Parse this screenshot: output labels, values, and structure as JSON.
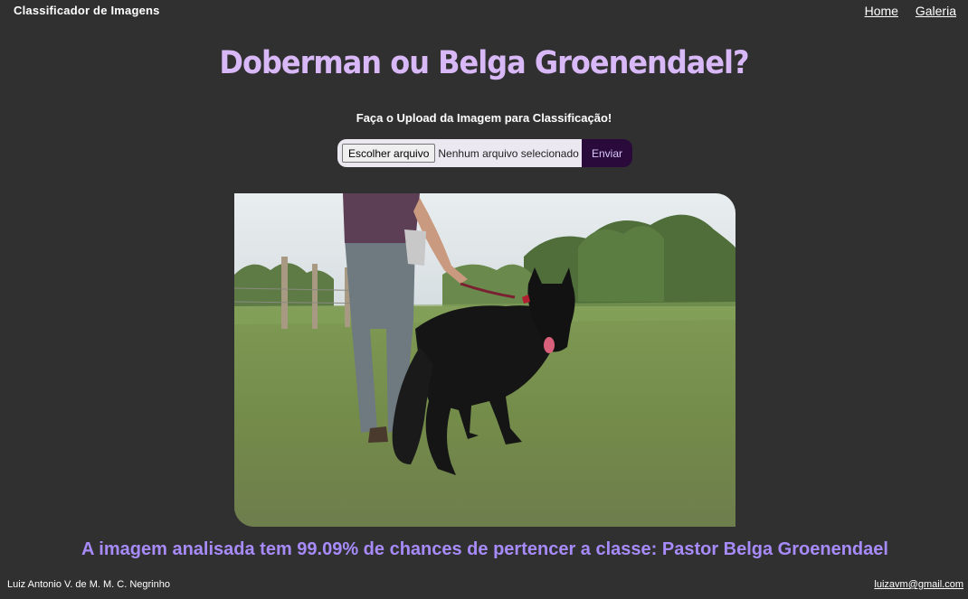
{
  "header": {
    "brand": "Classificador de Imagens",
    "nav": {
      "home": "Home",
      "gallery": "Galeria"
    }
  },
  "main": {
    "title": "Doberman ou Belga Groenendael?",
    "upload": {
      "caption": "Faça o Upload da Imagem para Classificação!",
      "choose_file_label": "Escolher arquivo",
      "file_status": "Nenhum arquivo selecionado",
      "submit_label": "Enviar"
    },
    "image": {
      "alt": "black-groenendael-dog-on-leash-photo"
    },
    "result": "A imagem analisada tem 99.09% de chances de pertencer a classe: Pastor Belga Groenendael"
  },
  "footer": {
    "author": "Luiz Antonio V. de M. M. C. Negrinho",
    "email": "luizavm@gmail.com"
  },
  "colors": {
    "background": "#303030",
    "title": "#d9b8f7",
    "result": "#a78bfa",
    "submit_button": "#2a0a3a"
  }
}
